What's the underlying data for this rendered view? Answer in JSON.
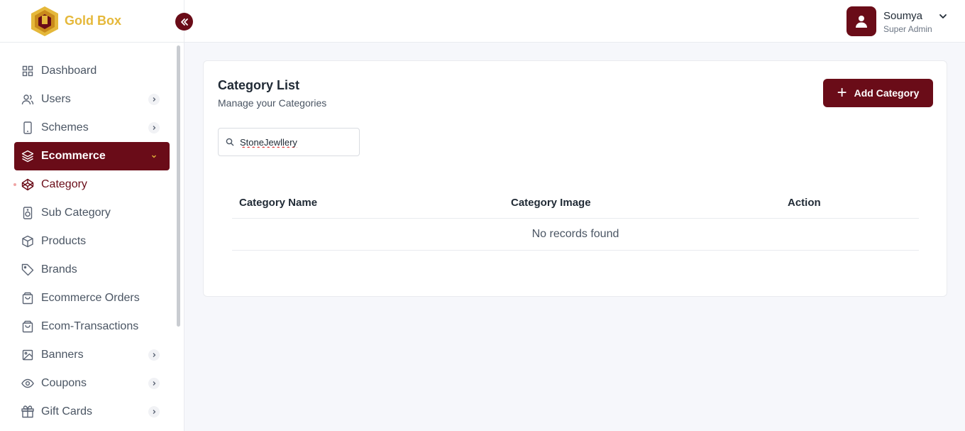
{
  "brand": {
    "name": "Gold Box",
    "logo_icon": "gold-box-logo",
    "primary_color": "#6a0c18",
    "gold_color": "#e5b83a"
  },
  "sidebar": {
    "items": [
      {
        "label": "Dashboard",
        "icon": "grid-icon",
        "has_chevron": false
      },
      {
        "label": "Users",
        "icon": "users-icon",
        "has_chevron": true
      },
      {
        "label": "Schemes",
        "icon": "mobile-icon",
        "has_chevron": true
      },
      {
        "label": "Ecommerce",
        "icon": "layers-icon",
        "has_chevron": true,
        "active": true,
        "expanded": true
      },
      {
        "label": "Category",
        "icon": "codepen-icon",
        "has_chevron": false,
        "current": true
      },
      {
        "label": "Sub Category",
        "icon": "speaker-icon",
        "has_chevron": false
      },
      {
        "label": "Products",
        "icon": "box-icon",
        "has_chevron": false
      },
      {
        "label": "Brands",
        "icon": "tag-icon",
        "has_chevron": false
      },
      {
        "label": "Ecommerce Orders",
        "icon": "shopping-bag-icon",
        "has_chevron": false
      },
      {
        "label": "Ecom-Transactions",
        "icon": "shopping-bag-icon",
        "has_chevron": false
      },
      {
        "label": "Banners",
        "icon": "image-icon",
        "has_chevron": true
      },
      {
        "label": "Coupons",
        "icon": "eye-icon",
        "has_chevron": true
      },
      {
        "label": "Gift Cards",
        "icon": "gift-icon",
        "has_chevron": true
      }
    ]
  },
  "header": {
    "user_name": "Soumya",
    "user_role": "Super Admin"
  },
  "main": {
    "title": "Category List",
    "subtitle": "Manage your Categories",
    "add_button_label": "Add Category",
    "search_value": "StoneJewllery",
    "table": {
      "columns": [
        "Category Name",
        "Category Image",
        "Action"
      ],
      "empty_message": "No records found"
    }
  }
}
